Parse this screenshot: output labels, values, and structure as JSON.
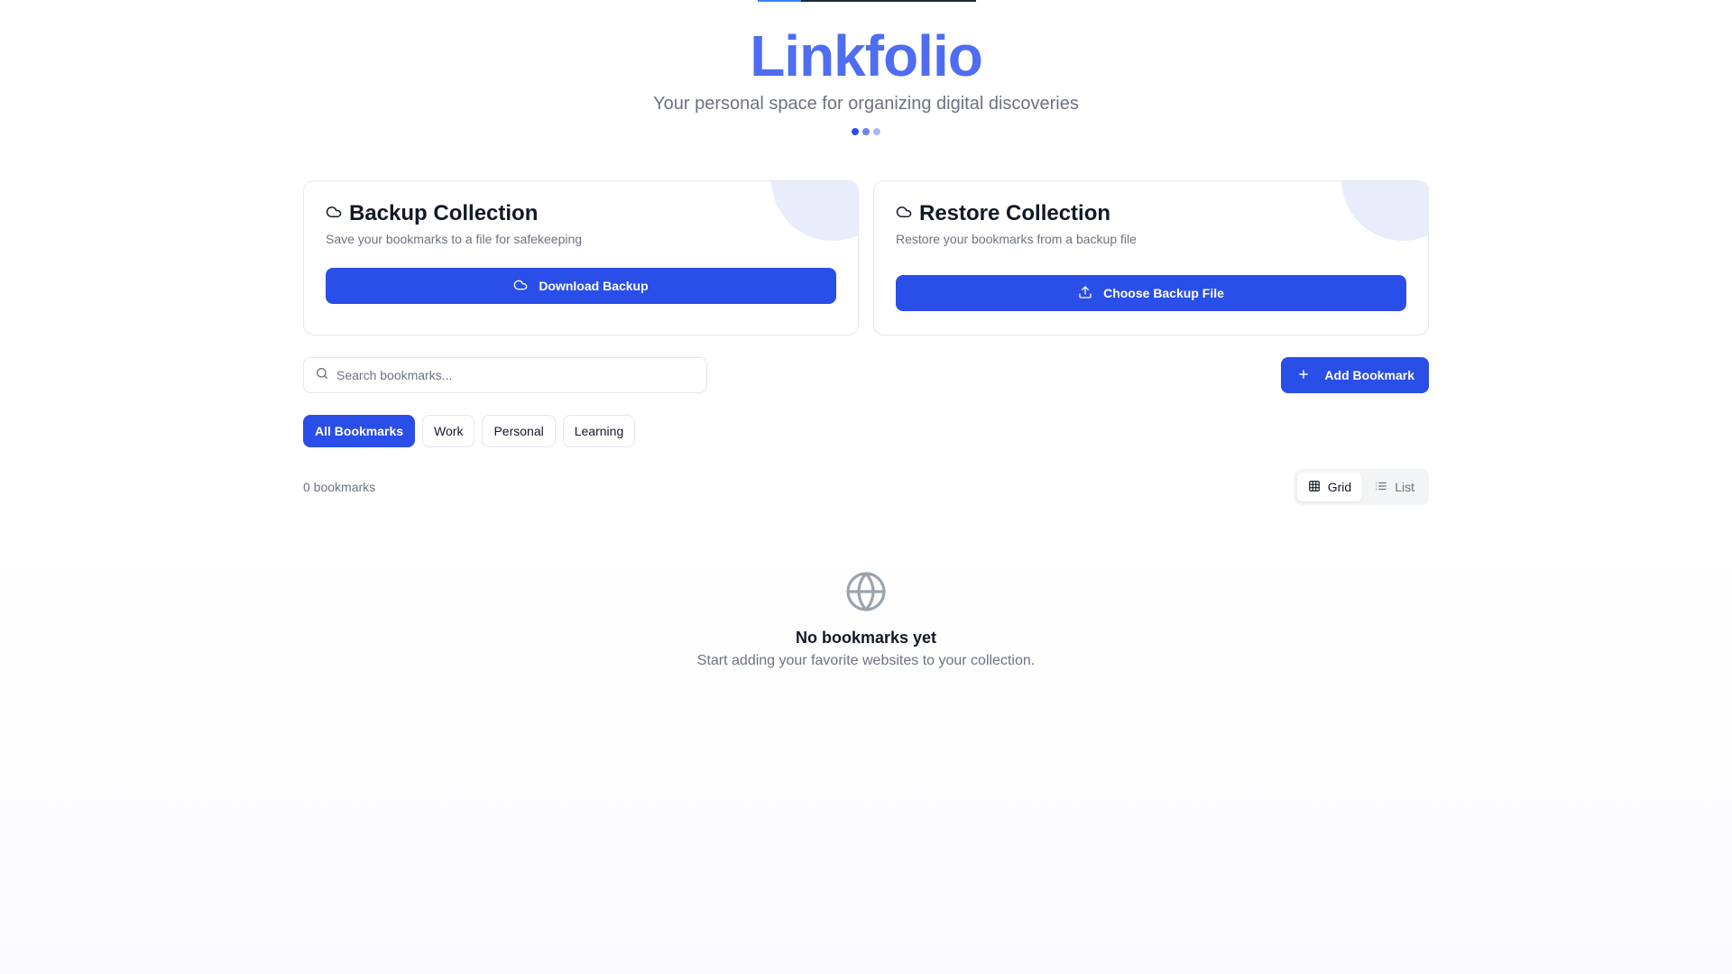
{
  "header": {
    "title": "Linkfolio",
    "subtitle": "Your personal space for organizing digital discoveries",
    "dot_colors": [
      "#2a4ee8",
      "#6b85f0",
      "#a9b8f7"
    ]
  },
  "backup_card": {
    "title": "Backup Collection",
    "description": "Save your bookmarks to a file for safekeeping",
    "button_label": "Download Backup",
    "icon": "cloud-icon"
  },
  "restore_card": {
    "title": "Restore Collection",
    "description": "Restore your bookmarks from a backup file",
    "button_label": "Choose Backup File",
    "icon": "cloud-icon"
  },
  "search": {
    "placeholder": "Search bookmarks...",
    "value": ""
  },
  "add_button": {
    "label": "Add Bookmark"
  },
  "filters": [
    {
      "label": "All Bookmarks",
      "active": true
    },
    {
      "label": "Work",
      "active": false
    },
    {
      "label": "Personal",
      "active": false
    },
    {
      "label": "Learning",
      "active": false
    }
  ],
  "meta": {
    "count_label": "0 bookmarks"
  },
  "view_toggle": {
    "grid_label": "Grid",
    "list_label": "List",
    "active": "grid"
  },
  "empty_state": {
    "title": "No bookmarks yet",
    "description": "Start adding your favorite websites to your collection.",
    "icon": "globe-icon"
  },
  "colors": {
    "brand": "#4f6df0",
    "primary": "#2a4ee8",
    "muted_text": "#6b7280",
    "border": "#e5e7eb"
  }
}
